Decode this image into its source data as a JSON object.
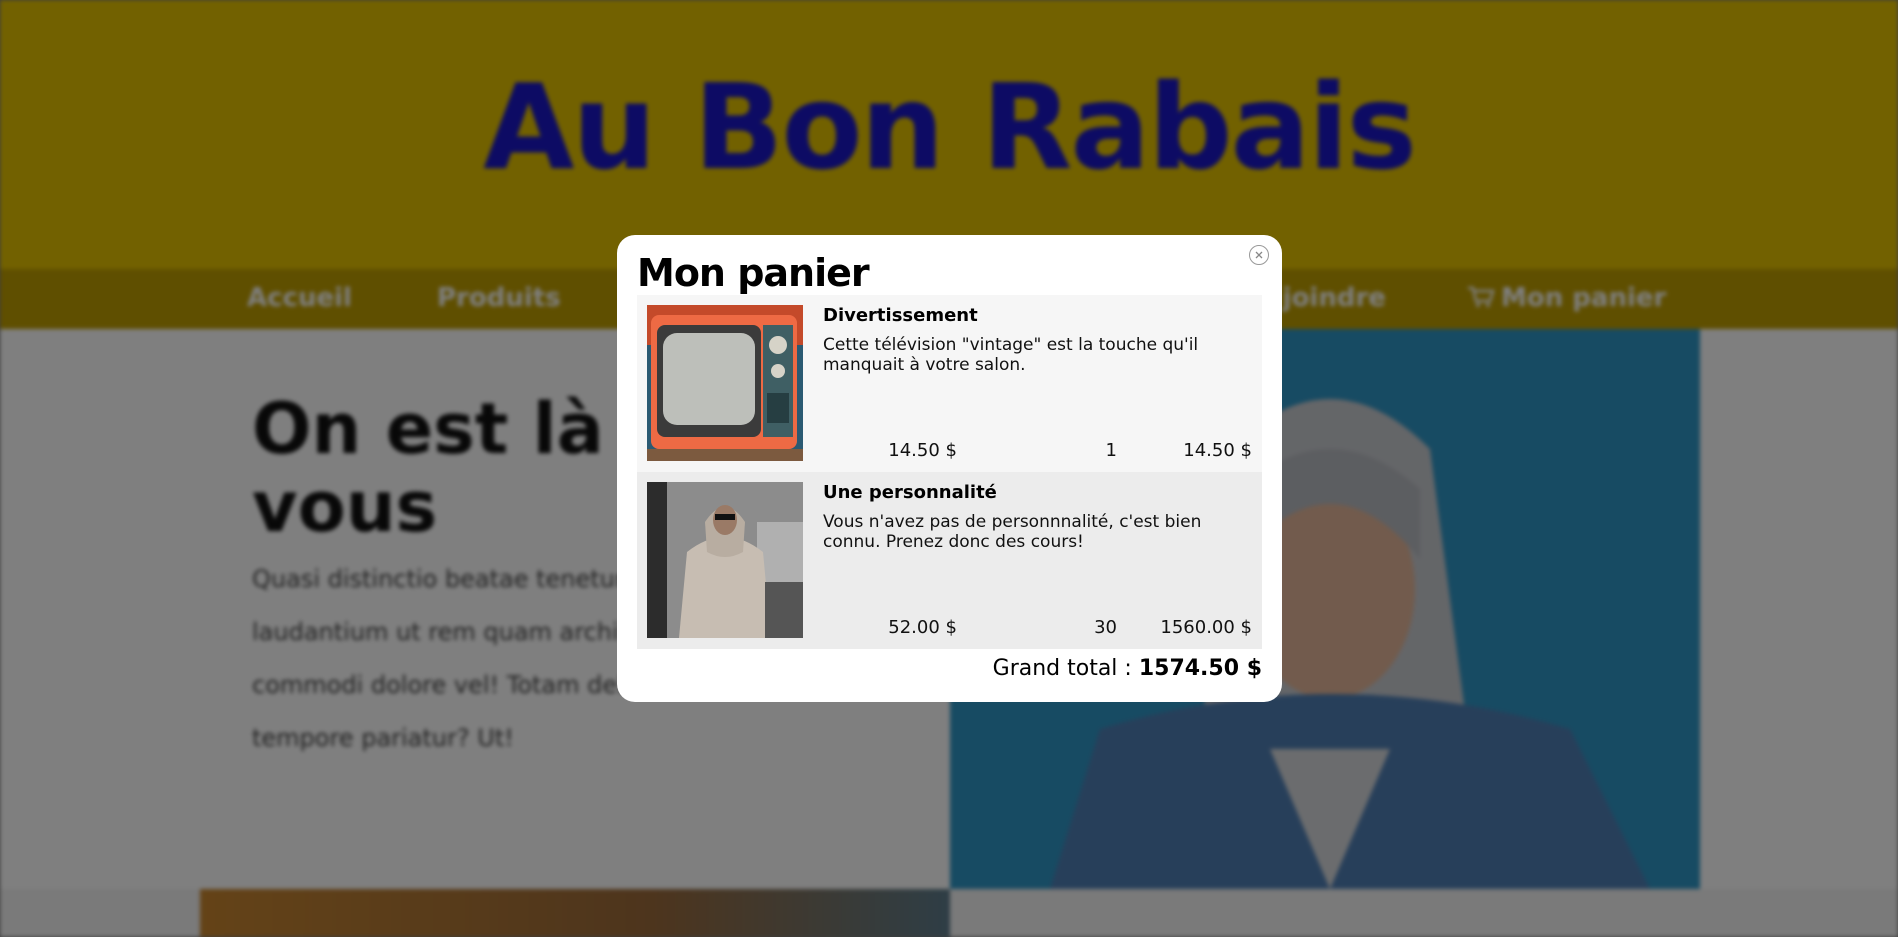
{
  "site": {
    "title": "Au Bon Rabais"
  },
  "nav": {
    "items": [
      {
        "label": "Accueil"
      },
      {
        "label": "Produits"
      },
      {
        "label": "Nous joindre"
      },
      {
        "label": "Mon panier",
        "icon": "cart-icon"
      }
    ]
  },
  "hero": {
    "title": "On est là pour vous",
    "text": "Quasi distinctio beatae tenetur repellendus dolor alias laudantium ut rem quam architecto ipsam dolores commodi dolore vel! Totam delectus debitis eum tempore pariatur? Ut!"
  },
  "modal": {
    "title": "Mon panier",
    "close_icon": "close-icon",
    "items": [
      {
        "name": "Divertissement",
        "description": "Cette télévision \"vintage\" est la touche qu'il manquait à votre salon.",
        "price": "14.50 $",
        "quantity": "1",
        "total": "14.50 $",
        "image": "vintage-tv"
      },
      {
        "name": "Une personnalité",
        "description": "Vous n'avez pas de personnnalité, c'est bien connu. Prenez donc des cours!",
        "price": "52.00 $",
        "quantity": "30",
        "total": "1560.00 $",
        "image": "person-hoodie"
      }
    ],
    "grand_total_label": "Grand total : ",
    "grand_total_value": "1574.50 $"
  },
  "colors": {
    "header_bg": "#e5c300",
    "title_color": "#1a17c8",
    "nav_bg": "#bf9e00"
  }
}
